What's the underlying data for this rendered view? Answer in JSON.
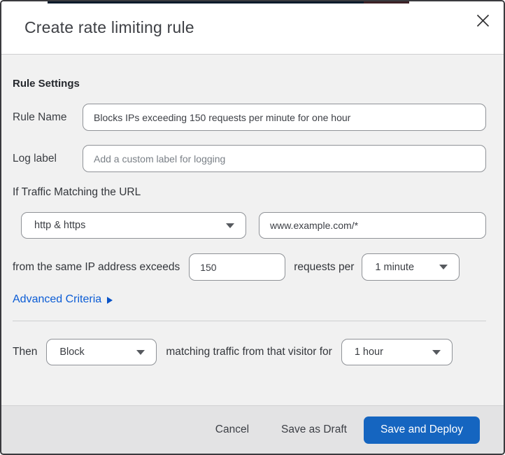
{
  "dialog": {
    "title": "Create rate limiting rule"
  },
  "icons": {
    "close_icon": "x-cross",
    "caret_down_icon": "triangle-down",
    "arrow_right_icon": "triangle-right"
  },
  "rule_settings": {
    "heading": "Rule Settings",
    "rule_name": {
      "label": "Rule Name",
      "value": "Blocks IPs exceeding 150 requests per minute for one hour"
    },
    "log_label": {
      "label": "Log label",
      "placeholder": "Add a custom label for logging"
    }
  },
  "match": {
    "heading": "If Traffic Matching the URL",
    "scheme_select": {
      "value": "http & https"
    },
    "url_input": {
      "value": "www.example.com/*"
    },
    "threshold_text_before": "from the same IP address exceeds",
    "threshold_input": {
      "value": "150"
    },
    "threshold_text_after": "requests per",
    "period_select": {
      "value": "1 minute"
    },
    "advanced_link_label": "Advanced Criteria"
  },
  "action": {
    "then_label": "Then",
    "action_select": {
      "value": "Block"
    },
    "middle_text": "matching traffic from that visitor for",
    "duration_select": {
      "value": "1 hour"
    }
  },
  "footer": {
    "cancel_label": "Cancel",
    "save_draft_label": "Save as Draft",
    "save_deploy_label": "Save and Deploy"
  },
  "colors": {
    "primary_button": "#1565c0",
    "link_blue": "#0b5cd5",
    "body_bg": "#f1f1f1",
    "footer_bg": "#e3e3e4",
    "border_dark": "#3a3a3e"
  }
}
